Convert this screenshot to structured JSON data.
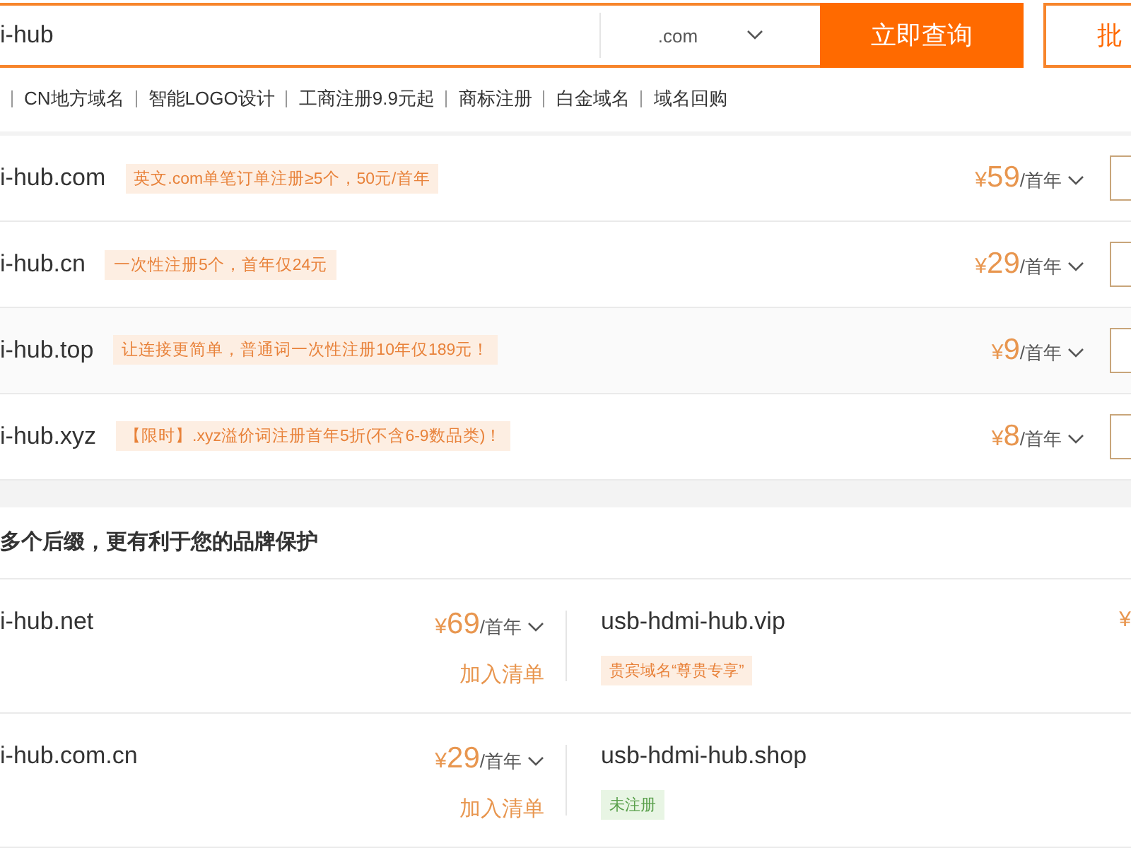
{
  "search": {
    "value": "i-hub",
    "suffix": ".com",
    "submit": "立即查询",
    "batch": "批"
  },
  "links": [
    "CN地方域名",
    "智能LOGO设计",
    "工商注册9.9元起",
    "商标注册",
    "白金域名",
    "域名回购"
  ],
  "results": [
    {
      "name": "i-hub.com",
      "promo": "英文.com单笔订单注册≥5个，50元/首年",
      "currency": "¥",
      "price": "59",
      "unit": "/首年",
      "checked": false
    },
    {
      "name": "i-hub.cn",
      "promo": "一次性注册5个，首年仅24元",
      "currency": "¥",
      "price": "29",
      "unit": "/首年",
      "checked": false
    },
    {
      "name": "i-hub.top",
      "promo": "让连接更简单，普通词一次性注册10年仅189元！",
      "currency": "¥",
      "price": "9",
      "unit": "/首年",
      "checked": false
    },
    {
      "name": "i-hub.xyz",
      "promo": "【限时】.xyz溢价词注册首年5折(不含6-9数品类)！",
      "currency": "¥",
      "price": "8",
      "unit": "/首年",
      "checked": false
    }
  ],
  "suggest_title": "多个后缀，更有利于您的品牌保护",
  "suggestions": [
    {
      "name": "i-hub.net",
      "currency": "¥",
      "price": "69",
      "unit": "/首年",
      "action": "加入清单"
    },
    {
      "name": "usb-hdmi-hub.vip",
      "tag": {
        "kind": "promo",
        "text": "贵宾域名“尊贵专享”"
      },
      "currency": "¥"
    },
    {
      "name": "i-hub.com.cn",
      "currency": "¥",
      "price": "29",
      "unit": "/首年",
      "action": "加入清单"
    },
    {
      "name": "usb-hdmi-hub.shop",
      "tag": {
        "kind": "status",
        "text": "未注册"
      }
    }
  ]
}
